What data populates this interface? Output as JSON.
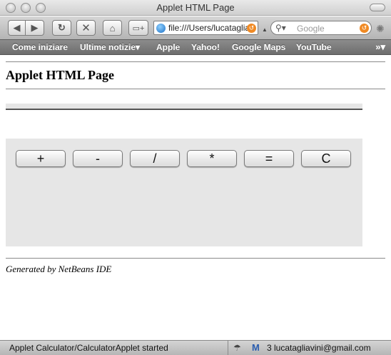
{
  "window": {
    "title": "Applet HTML Page"
  },
  "toolbar": {
    "back_icon": "back-arrow-icon",
    "forward_icon": "forward-arrow-icon",
    "reload_icon": "reload-icon",
    "stop_icon": "stop-icon",
    "home_icon": "home-icon",
    "bookmark_icon": "add-bookmark-icon",
    "address_value": "file:///Users/lucataglia",
    "search_placeholder": "Google"
  },
  "bookmarks": [
    {
      "label": "Come iniziare"
    },
    {
      "label": "Ultime notizie▾"
    },
    {
      "label": "Apple"
    },
    {
      "label": "Yahoo!"
    },
    {
      "label": "Google Maps"
    },
    {
      "label": "YouTube"
    }
  ],
  "page": {
    "heading": "Applet HTML Page",
    "footer": "Generated by NetBeans IDE"
  },
  "calculator": {
    "buttons": [
      "+",
      "-",
      "/",
      "*",
      "=",
      "C"
    ]
  },
  "status": {
    "message": "Applet Calculator/CalculatorApplet started",
    "mail": "3 lucatagliavini@gmail.com"
  },
  "colors": {
    "applet_bg": "#e6e6e6",
    "bookmarks_bg": "#7d7d7d",
    "feed_orange": "#f08a24"
  }
}
